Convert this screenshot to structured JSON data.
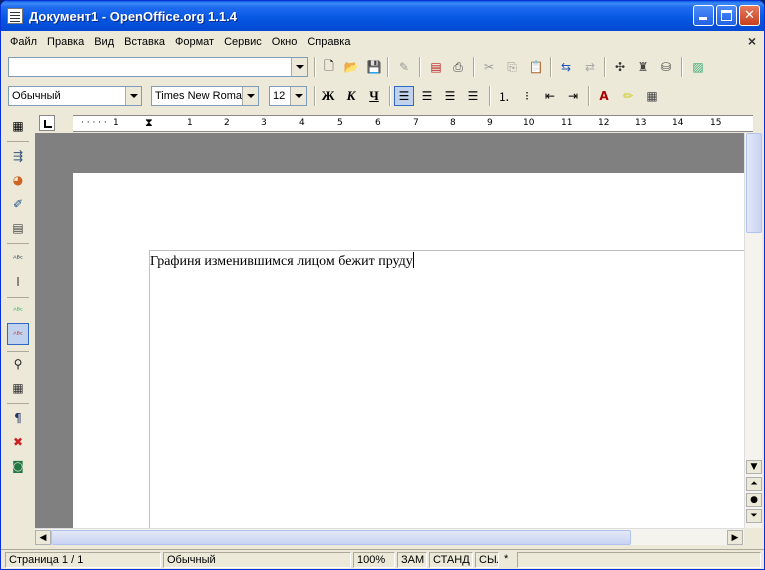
{
  "window": {
    "title": "Документ1 - OpenOffice.org 1.1.4"
  },
  "menu": {
    "items": [
      {
        "label": "Файл"
      },
      {
        "label": "Правка"
      },
      {
        "label": "Вид"
      },
      {
        "label": "Вставка"
      },
      {
        "label": "Формат"
      },
      {
        "label": "Сервис"
      },
      {
        "label": "Окно"
      },
      {
        "label": "Справка"
      }
    ],
    "close_glyph": "×"
  },
  "toolbar": {
    "url_value": "",
    "style_value": "Обычный",
    "font_value": "Times New Roman",
    "size_value": "12",
    "bold_label": "Ж",
    "italic_label": "К",
    "underline_label": "Ч"
  },
  "ruler": {
    "numbers": [
      "1",
      "1",
      "2",
      "3",
      "4",
      "5",
      "6",
      "7",
      "8",
      "9",
      "10",
      "11",
      "12",
      "13",
      "14",
      "15"
    ]
  },
  "document": {
    "text": "Графиня изменившимся лицом бежит пруду"
  },
  "statusbar": {
    "page": "Страница  1 / 1",
    "style": "Обычный",
    "zoom": "100%",
    "mode_ins": "ЗАМ",
    "mode_sel": "СТАНД",
    "mode_hyper": "СЫЛ",
    "modified": "*"
  },
  "icons": {
    "app": "writer-document-icon",
    "minimize": "minimize-icon",
    "maximize": "maximize-icon",
    "close": "close-icon"
  }
}
